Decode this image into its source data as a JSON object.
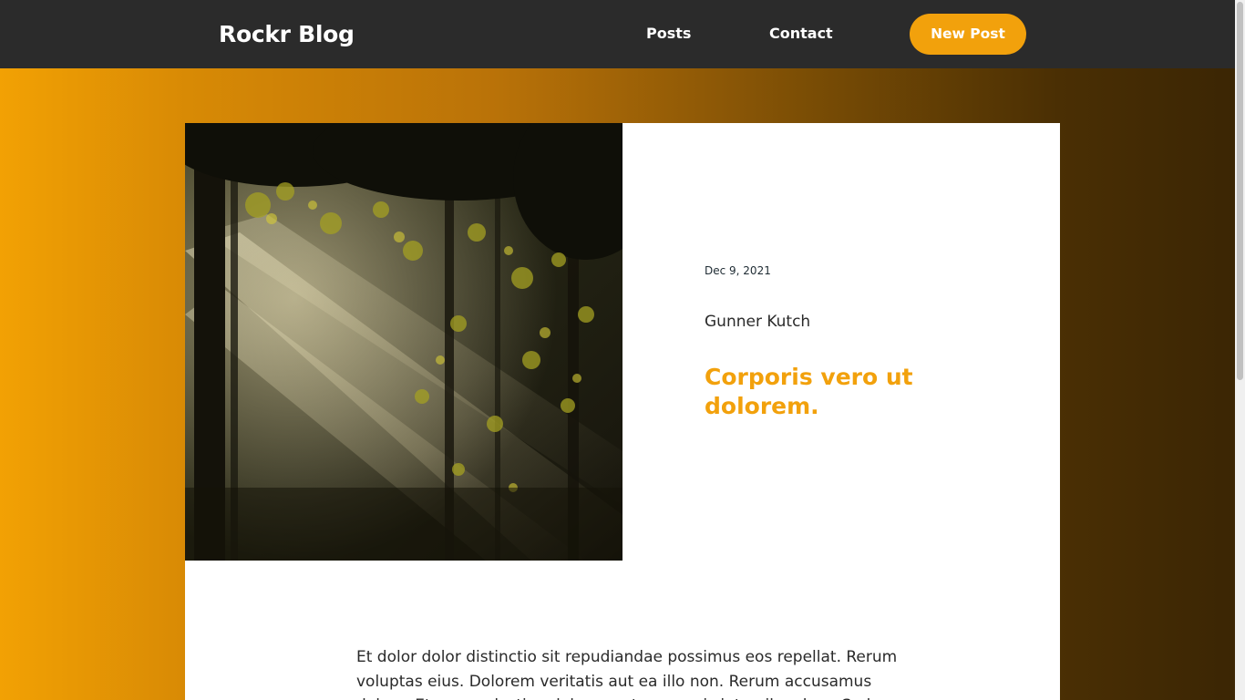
{
  "header": {
    "logo": "Rockr Blog",
    "nav": {
      "posts": "Posts",
      "contact": "Contact"
    },
    "new_post_label": "New Post"
  },
  "post": {
    "image_alt": "sunlight through forest trees",
    "date": "Dec 9, 2021",
    "author": "Gunner Kutch",
    "title": "Corporis vero ut dolorem.",
    "body": "Et dolor dolor distinctio sit repudiandae possimus eos repellat. Rerum voluptas eius. Dolorem veritatis aut ea illo non. Rerum accusamus dolore. Et non molestiae dolores aut ex quasi sint quibusdam. Sed"
  },
  "colors": {
    "accent": "#f2a10c",
    "header_bg": "#2b2b2b",
    "text_dark": "#2a2a2a"
  },
  "icons": {
    "hero": "forest-photo"
  }
}
